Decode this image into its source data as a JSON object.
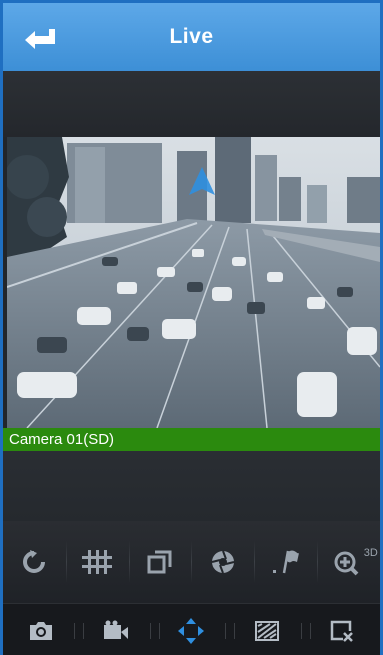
{
  "header": {
    "title": "Live"
  },
  "video": {
    "camera_label": "Camera 01(SD)"
  },
  "toolbar_top": {
    "items": [
      {
        "icon": "refresh-icon"
      },
      {
        "icon": "layout-grid-icon"
      },
      {
        "icon": "window-switch-icon"
      },
      {
        "icon": "aperture-icon"
      },
      {
        "icon": "flag-icon"
      },
      {
        "icon": "zoom-3d-icon",
        "badge": "3D"
      }
    ]
  },
  "toolbar_bottom": {
    "items": [
      {
        "icon": "camera-icon"
      },
      {
        "icon": "video-record-icon"
      },
      {
        "icon": "ptz-direction-icon"
      },
      {
        "icon": "image-adjust-icon"
      },
      {
        "icon": "close-window-icon"
      }
    ]
  },
  "colors": {
    "header": "#3d8fd6",
    "camera_bar": "#2b8a0e",
    "active_icon": "#2f8fe0",
    "icon": "#9aa3ad"
  }
}
